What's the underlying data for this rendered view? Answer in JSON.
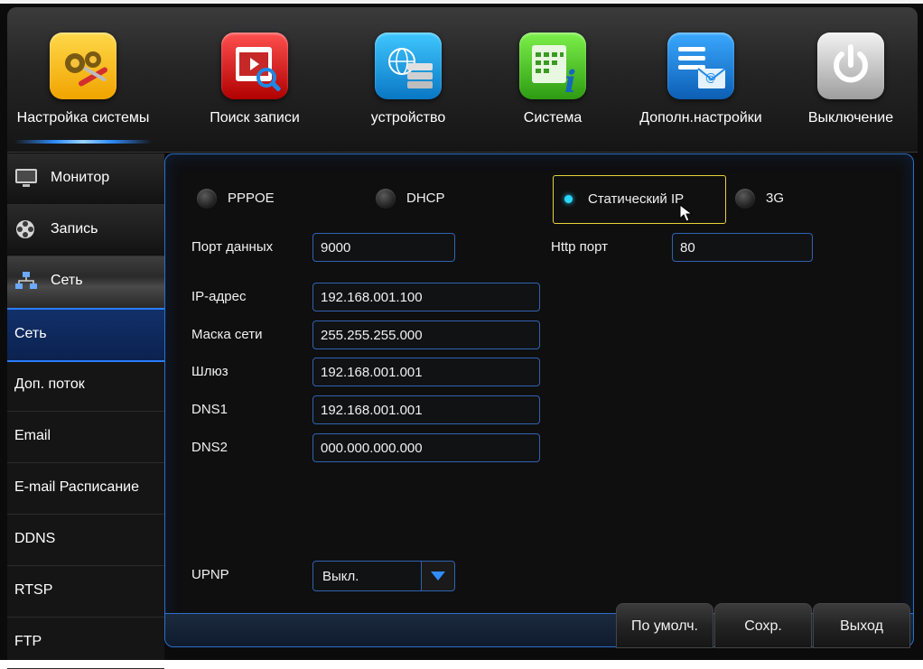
{
  "top_menu": [
    {
      "label": "Настройка системы",
      "icon": "system-settings-icon",
      "active": true
    },
    {
      "label": "Поиск записи",
      "icon": "record-search-icon"
    },
    {
      "label": "устройство",
      "icon": "device-storage-icon"
    },
    {
      "label": "Система",
      "icon": "system-info-icon"
    },
    {
      "label": "Дополн.настройки",
      "icon": "advanced-settings-icon"
    },
    {
      "label": "Выключение",
      "icon": "power-icon"
    }
  ],
  "sidebar": {
    "sections": [
      {
        "label": "Монитор",
        "icon": "monitor-icon"
      },
      {
        "label": "Запись",
        "icon": "film-reel-icon"
      },
      {
        "label": "Сеть",
        "icon": "network-icon",
        "active": true
      }
    ],
    "items": [
      {
        "label": "Сеть",
        "active": true
      },
      {
        "label": "Доп. поток"
      },
      {
        "label": "Email"
      },
      {
        "label": "E-mail Расписание"
      },
      {
        "label": "DDNS"
      },
      {
        "label": "RTSP"
      },
      {
        "label": "FTP"
      }
    ]
  },
  "network": {
    "modes": [
      {
        "label": "PPPOE",
        "selected": false
      },
      {
        "label": "DHCP",
        "selected": false
      },
      {
        "label": "Статический IP",
        "selected": true
      },
      {
        "label": "3G",
        "selected": false
      }
    ],
    "data_port": {
      "label": "Порт данных",
      "value": "9000"
    },
    "http_port": {
      "label": "Http порт",
      "value": "80"
    },
    "ip": {
      "label": "IP-адрес",
      "value": "192.168.001.100"
    },
    "mask": {
      "label": "Маска сети",
      "value": "255.255.255.000"
    },
    "gateway": {
      "label": "Шлюз",
      "value": "192.168.001.001"
    },
    "dns1": {
      "label": "DNS1",
      "value": "192.168.001.001"
    },
    "dns2": {
      "label": "DNS2",
      "value": "000.000.000.000"
    },
    "upnp": {
      "label": "UPNP",
      "value": "Выкл."
    }
  },
  "buttons": {
    "default": "По умолч.",
    "save": "Сохр.",
    "exit": "Выход"
  },
  "colors": {
    "accent_border": "#2f63b0",
    "selected_outline": "#e6d33a",
    "selected_dot": "#28d8ff",
    "active_nav": "#12306a"
  }
}
